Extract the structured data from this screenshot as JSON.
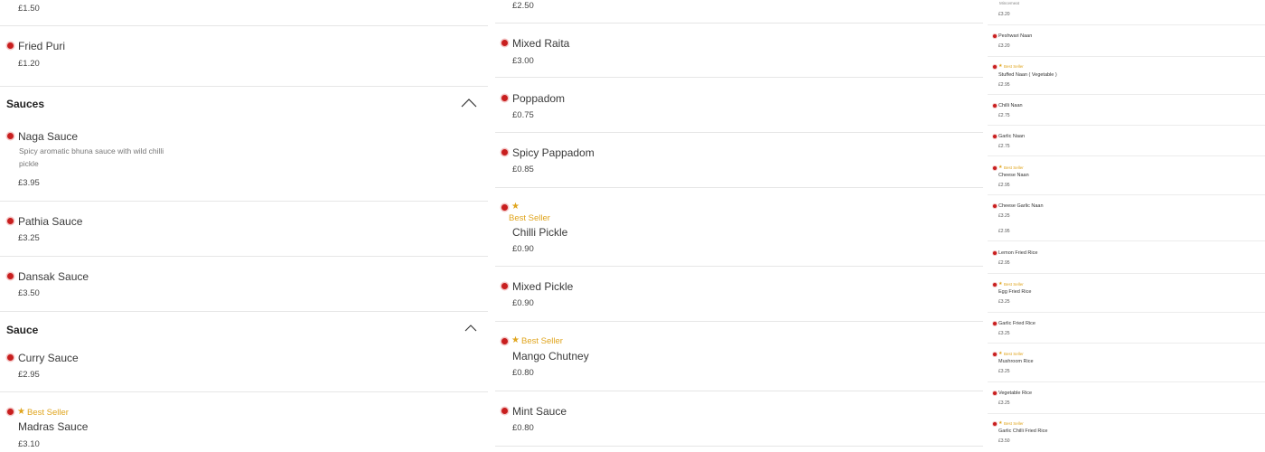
{
  "col1": {
    "top_price": "£1.50",
    "fried_puri": {
      "name": "Fried Puri",
      "price": "£1.20"
    },
    "sauces_section": {
      "title": "Sauces"
    },
    "naga": {
      "name": "Naga Sauce",
      "desc": "Spicy aromatic bhuna sauce with wild chilli pickle",
      "price": "£3.95"
    },
    "pathia": {
      "name": "Pathia Sauce",
      "price": "£3.25"
    },
    "dansak": {
      "name": "Dansak Sauce",
      "price": "£3.50"
    },
    "sauce_section": {
      "title": "Sauce"
    },
    "curry": {
      "name": "Curry Sauce",
      "price": "£2.95"
    },
    "madras": {
      "badge": "Best Seller",
      "name": "Madras Sauce",
      "price": "£3.10"
    }
  },
  "col2": {
    "top_price": "£2.50",
    "mixed_raita": {
      "name": "Mixed Raita",
      "price": "£3.00"
    },
    "poppadom": {
      "name": "Poppadom",
      "price": "£0.75"
    },
    "spicy_pappadom": {
      "name": "Spicy Pappadom",
      "price": "£0.85"
    },
    "chilli_pickle": {
      "badge": "Best Seller",
      "name": "Chilli Pickle",
      "price": "£0.90"
    },
    "mixed_pickle": {
      "name": "Mixed Pickle",
      "price": "£0.90"
    },
    "mango_chutney": {
      "badge": "Best Seller",
      "name": "Mango Chutney",
      "price": "£0.80"
    },
    "mint_sauce": {
      "name": "Mint Sauce",
      "price": "£0.80"
    }
  },
  "col3": {
    "top_label": "Mincemeat",
    "top_price": "£3.20",
    "items": [
      {
        "name": "Peshwari Naan",
        "price": "£3.20",
        "badge": ""
      },
      {
        "name": "Stuffed Naan ( Vegetable )",
        "price": "£2.95",
        "badge": "Best Seller"
      },
      {
        "name": "Chilli Naan",
        "price": "£2.75",
        "badge": ""
      },
      {
        "name": "Garlic Naan",
        "price": "£2.75",
        "badge": ""
      },
      {
        "name": "Cheese Naan",
        "price": "£2.95",
        "badge": "Best Seller"
      },
      {
        "name": "Cheese Garlic Naan",
        "price": "£3.25",
        "price2": "£2.95",
        "badge": ""
      },
      {
        "name": "Lemon Fried Rice",
        "price": "£2.95",
        "badge": ""
      },
      {
        "name": "Egg Fried Rice",
        "price": "£3.25",
        "badge": "Best Seller"
      },
      {
        "name": "Garlic Fried Rice",
        "price": "£3.25",
        "badge": ""
      },
      {
        "name": "Mushroom Rice",
        "price": "£3.25",
        "badge": "Best Seller"
      },
      {
        "name": "Vegetable Rice",
        "price": "£3.25",
        "badge": ""
      },
      {
        "name": "Garlic Chilli Fried Rice",
        "price": "£3.50",
        "badge": "Best Seller"
      }
    ]
  },
  "colors": {
    "accent_dot": "#c81e1e",
    "best_seller": "#e0a51e",
    "divider": "#e6e6e6"
  },
  "icons": {
    "item_marker": "veg-dot-icon",
    "badge": "star-icon",
    "collapse": "chevron-up-icon"
  }
}
